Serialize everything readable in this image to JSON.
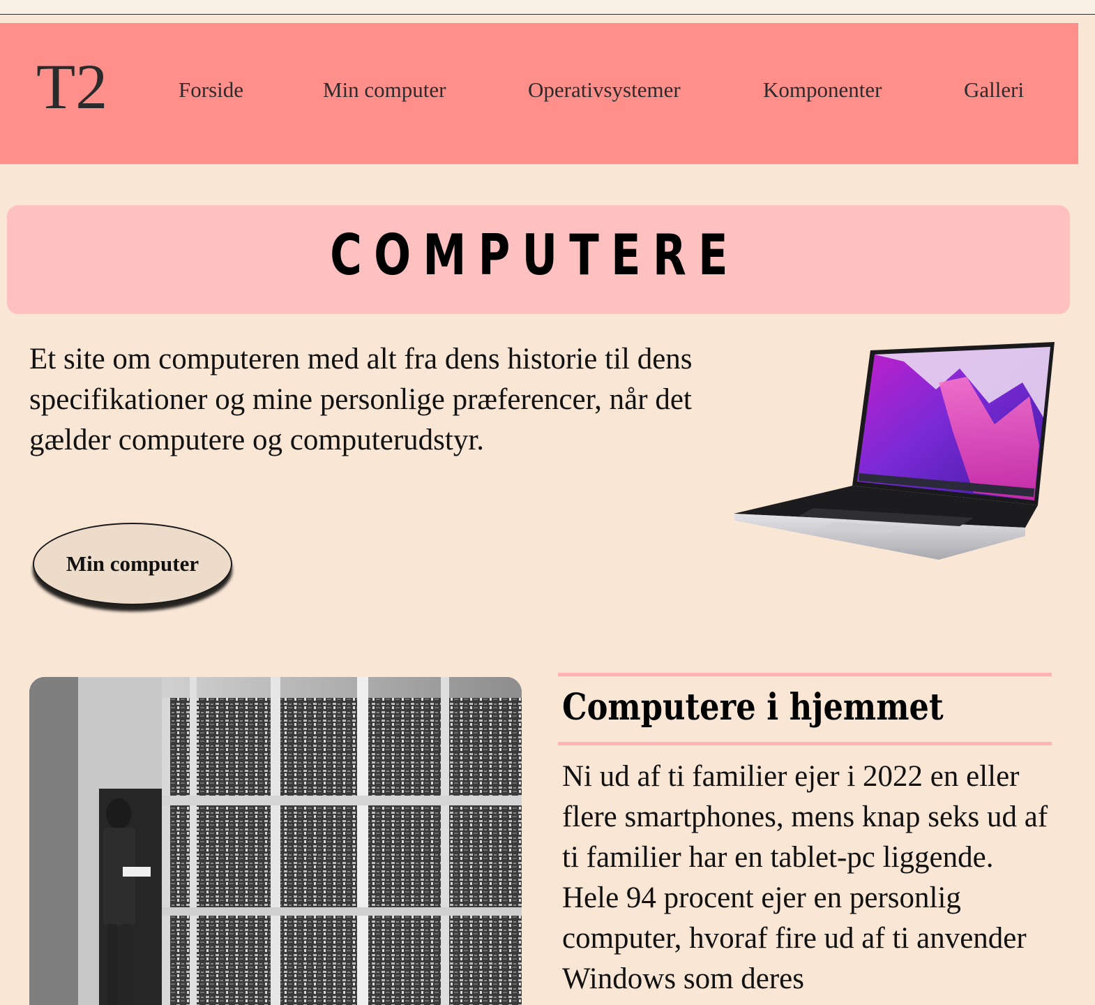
{
  "header": {
    "logo": "T2",
    "nav": [
      {
        "label": "Forside"
      },
      {
        "label": "Min computer"
      },
      {
        "label": "Operativsystemer"
      },
      {
        "label": "Komponenter"
      },
      {
        "label": "Galleri"
      }
    ]
  },
  "hero": {
    "title": "COMPUTERE",
    "intro": "Et site om computeren med alt fra dens historie til dens specifikationer og mine personlige præferencer, når det gælder computere og computerudstyr.",
    "cta_label": "Min computer"
  },
  "section": {
    "title": "Computere i hjemmet",
    "body": "Ni ud af ti familier ejer i 2022 en eller flere smartphones, mens knap seks ud af ti familier har en tablet-pc liggende. Hele 94 procent ejer en personlig computer, hvoraf fire ud af ti anvender Windows som deres"
  },
  "colors": {
    "page_background": "#f9e6d5",
    "header_background": "#ff8f8b",
    "banner_background": "#ffc0c0",
    "rule_color": "#ffb3b3",
    "button_background": "#eedccb"
  }
}
